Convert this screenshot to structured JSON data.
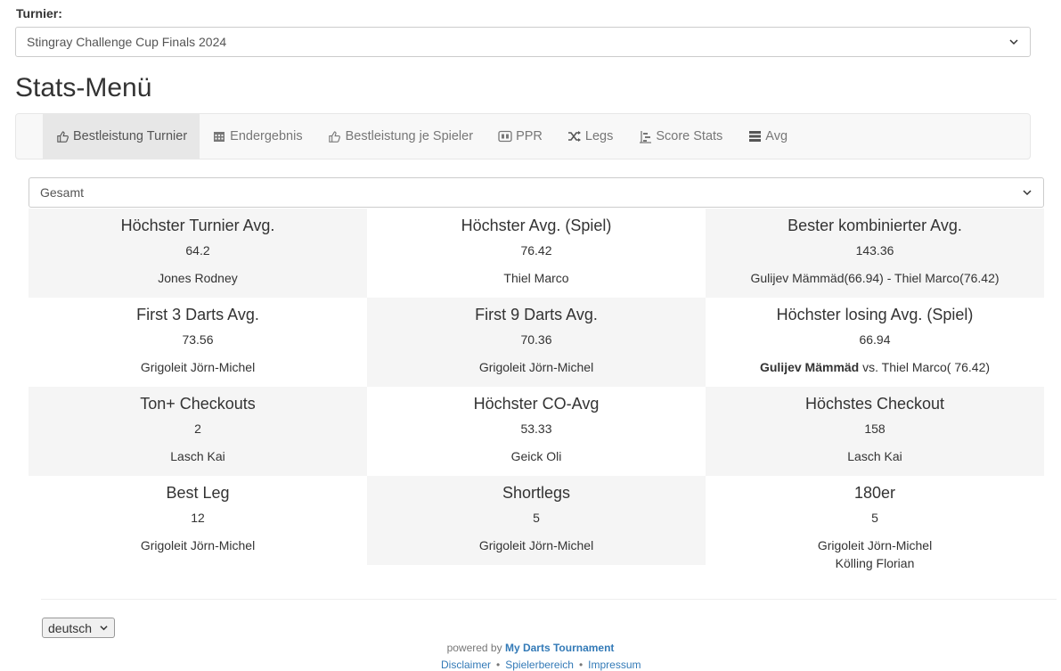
{
  "tournament_label": "Turnier:",
  "tournament_selected": "Stingray Challenge Cup Finals 2024",
  "page_title": "Stats-Menü",
  "nav": [
    {
      "label": "Bestleistung Turnier",
      "icon": "thumbs-up-icon",
      "active": true
    },
    {
      "label": "Endergebnis",
      "icon": "calendar-icon",
      "active": false
    },
    {
      "label": "Bestleistung je Spieler",
      "icon": "thumbs-up-icon",
      "active": false
    },
    {
      "label": "PPR",
      "icon": "ppr-icon",
      "active": false
    },
    {
      "label": "Legs",
      "icon": "shuffle-icon",
      "active": false
    },
    {
      "label": "Score Stats",
      "icon": "tree-icon",
      "active": false
    },
    {
      "label": "Avg",
      "icon": "list-icon",
      "active": false
    }
  ],
  "scope_selected": "Gesamt",
  "stats": [
    {
      "title": "Höchster Turnier Avg.",
      "value": "64.2",
      "player": "Jones Rodney"
    },
    {
      "title": "Höchster Avg. (Spiel)",
      "value": "76.42",
      "player": "Thiel Marco"
    },
    {
      "title": "Bester kombinierter Avg.",
      "value": "143.36",
      "player": "Gulijev Mämmäd(66.94) - Thiel Marco(76.42)"
    },
    {
      "title": "First 3 Darts Avg.",
      "value": "73.56",
      "player": "Grigoleit Jörn-Michel"
    },
    {
      "title": "First 9 Darts Avg.",
      "value": "70.36",
      "player": "Grigoleit Jörn-Michel"
    },
    {
      "title": "Höchster losing Avg. (Spiel)",
      "value": "66.94",
      "player_bold": "Gulijev Mämmäd",
      "player_rest": " vs. Thiel Marco( 76.42)"
    },
    {
      "title": "Ton+ Checkouts",
      "value": "2",
      "player": "Lasch Kai"
    },
    {
      "title": "Höchster CO-Avg",
      "value": "53.33",
      "player": "Geick Oli"
    },
    {
      "title": "Höchstes Checkout",
      "value": "158",
      "player": "Lasch Kai"
    },
    {
      "title": "Best Leg",
      "value": "12",
      "player": "Grigoleit Jörn-Michel"
    },
    {
      "title": "Shortlegs",
      "value": "5",
      "player": "Grigoleit Jörn-Michel"
    },
    {
      "title": "180er",
      "value": "5",
      "player": "Grigoleit Jörn-Michel",
      "player2": "Kölling Florian"
    }
  ],
  "language_selected": "deutsch",
  "powered_prefix": "powered by",
  "powered_brand": "My Darts Tournament",
  "footer_links": [
    "Disclaimer",
    "Spielerbereich",
    "Impressum"
  ],
  "footer_sep": "•"
}
